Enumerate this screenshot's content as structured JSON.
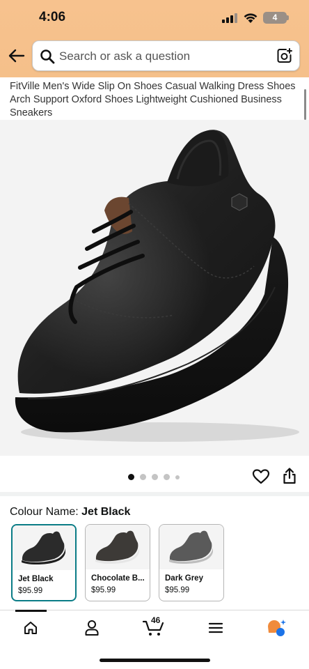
{
  "status_bar": {
    "time": "4:06",
    "battery": "4"
  },
  "search": {
    "placeholder": "Search or ask a question"
  },
  "product": {
    "title": "FitVille Men's Wide Slip On Shoes Casual Walking Dress Shoes Arch Support Oxford Shoes Lightweight Cushioned Business Sneakers",
    "image_icon": "black-leather-oxford-shoe",
    "carousel": {
      "count": 5,
      "active_index": 0
    }
  },
  "colour": {
    "label": "Colour Name:",
    "selected": "Jet Black",
    "options": [
      {
        "name": "Jet Black",
        "price": "$95.99",
        "shoe_color": "#2b2b2b",
        "sole_color": "#1e1e1e"
      },
      {
        "name": "Chocolate B...",
        "price": "$95.99",
        "shoe_color": "#3d3a37",
        "sole_color": "#e6e6e6"
      },
      {
        "name": "Dark Grey",
        "price": "$95.99",
        "shoe_color": "#5a5a5a",
        "sole_color": "#bdbdbd"
      }
    ]
  },
  "nav": {
    "cart_count": "46",
    "items": [
      "home-icon",
      "account-icon",
      "cart-icon",
      "menu-icon",
      "rufus-icon"
    ]
  },
  "colors": {
    "header": "#f6c18c",
    "selected_border": "#0a7c86",
    "rufus_orange": "#f08b3c",
    "rufus_blue": "#1b73e8"
  }
}
